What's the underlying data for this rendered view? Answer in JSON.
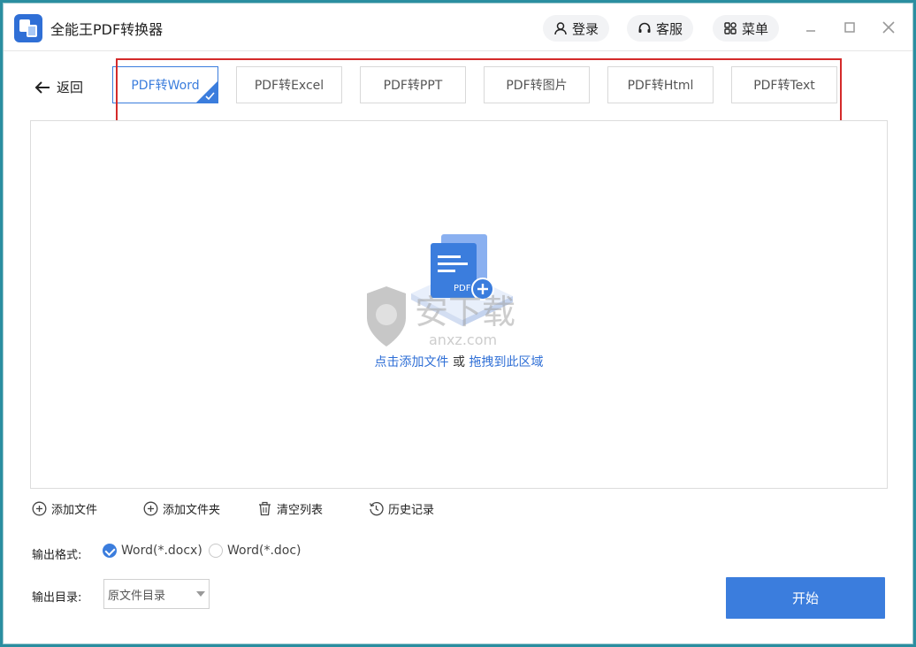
{
  "app": {
    "title": "全能王PDF转换器"
  },
  "header": {
    "login_label": "登录",
    "service_label": "客服",
    "menu_label": "菜单"
  },
  "nav": {
    "back_label": "返回"
  },
  "tabs": [
    {
      "label": "PDF转Word",
      "active": true
    },
    {
      "label": "PDF转Excel",
      "active": false
    },
    {
      "label": "PDF转PPT",
      "active": false
    },
    {
      "label": "PDF转图片",
      "active": false
    },
    {
      "label": "PDF转Html",
      "active": false
    },
    {
      "label": "PDF转Text",
      "active": false
    }
  ],
  "dropzone": {
    "add_link": "点击添加文件",
    "or_text": "或",
    "drag_link": "拖拽到此区域",
    "illustration_badge": "PDF"
  },
  "watermark": {
    "main": "安下载",
    "sub": "anxz.com"
  },
  "toolbar": {
    "add_file": "添加文件",
    "add_folder": "添加文件夹",
    "clear_list": "清空列表",
    "history": "历史记录"
  },
  "output": {
    "format_label": "输出格式:",
    "format_options": [
      {
        "label": "Word(*.docx)",
        "selected": true
      },
      {
        "label": "Word(*.doc)",
        "selected": false
      }
    ],
    "dir_label": "输出目录:",
    "dir_value": "原文件目录"
  },
  "actions": {
    "start_label": "开始"
  },
  "colors": {
    "accent": "#3b7ddd",
    "highlight_box": "#d42a2a"
  }
}
